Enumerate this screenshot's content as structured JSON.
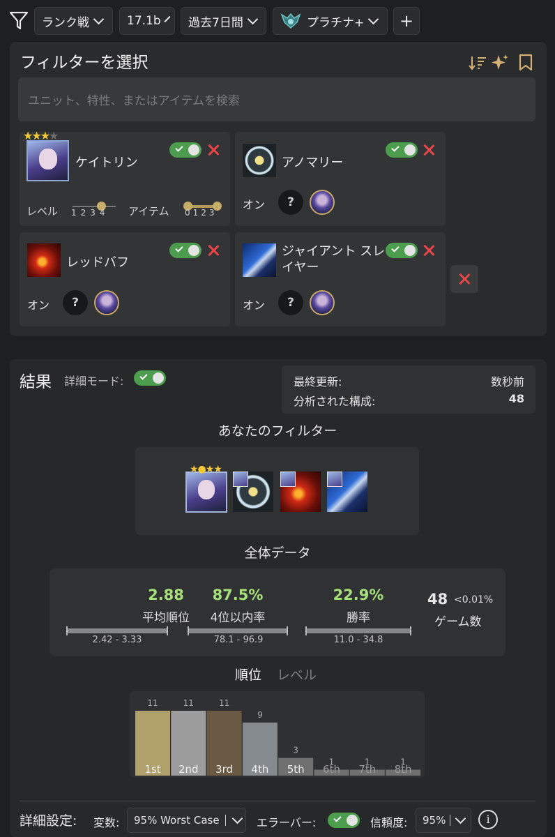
{
  "toolbar": {
    "mode": "ランク戦",
    "patch": "17.1b",
    "period": "過去7日間",
    "rank": "プラチナ+",
    "add": "+"
  },
  "filter_panel": {
    "title": "フィルターを選択",
    "search_placeholder": "ユニット、特性、またはアイテムを検索",
    "cards": [
      {
        "name": "ケイトリン",
        "level_label": "レベル",
        "level_ticks": [
          "1",
          "2",
          "3",
          "4"
        ],
        "item_label": "アイテム",
        "item_ticks": [
          "0",
          "1",
          "2",
          "3"
        ],
        "stars": 3
      },
      {
        "name": "アノマリー",
        "on_label": "オン"
      },
      {
        "name": "レッドバフ",
        "on_label": "オン"
      },
      {
        "name": "ジャイアント スレイヤー",
        "on_label": "オン"
      }
    ],
    "icons": [
      "sort-icon",
      "sparkle-icon",
      "bookmark-icon"
    ]
  },
  "results": {
    "title": "結果",
    "detail_mode_label": "詳細モード:",
    "last_updated_label": "最終更新:",
    "last_updated_value": "数秒前",
    "analyzed_label": "分析された構成:",
    "analyzed_value": "48",
    "your_filter_title": "あなたのフィルター",
    "overall_title": "全体データ",
    "stats": {
      "avg_place_value": "2.88",
      "avg_place_label": "平均順位",
      "avg_place_range": "2.42 - 3.33",
      "top4_value": "87.5%",
      "top4_label": "4位以内率",
      "top4_range": "78.1 - 96.9",
      "win_value": "22.9%",
      "win_label": "勝率",
      "win_range": "11.0 - 34.8",
      "games_value": "48",
      "games_pct": "<0.01%",
      "games_label": "ゲーム数"
    },
    "tabs": {
      "active": "順位",
      "inactive": "レベル"
    }
  },
  "chart_data": {
    "type": "bar",
    "categories": [
      "1st",
      "2nd",
      "3rd",
      "4th",
      "5th",
      "6th",
      "7th",
      "8th"
    ],
    "values": [
      11,
      11,
      11,
      9,
      3,
      1,
      1,
      1
    ],
    "colors": [
      "#b0a06a",
      "#9c9c9c",
      "#6a5a44",
      "#858a8f",
      "#6f6f6f",
      "#707070",
      "#707070",
      "#707070"
    ]
  },
  "settings": {
    "label": "詳細設定:",
    "variable_label": "変数:",
    "variable_value": "95% Worst Case",
    "error_bar_label": "エラーバー:",
    "confidence_label": "信頼度:",
    "confidence_value": "95%"
  },
  "colors": {
    "accent_green": "#a7e07b",
    "toggle_green": "#4c9d4e",
    "remove_red": "#e84747",
    "gold": "#c9a967"
  }
}
